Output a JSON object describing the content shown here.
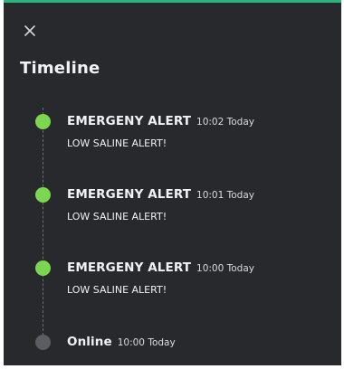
{
  "header": {
    "close_icon": "close-icon",
    "title": "Timeline"
  },
  "colors": {
    "background": "#27292c",
    "accent_top": "#2bb57a",
    "alert_dot": "#7cd64f",
    "online_dot": "#5a5d62"
  },
  "events": [
    {
      "title": "EMERGENY ALERT",
      "time": "10:02 Today",
      "message": "LOW SALINE ALERT!",
      "status": "alert"
    },
    {
      "title": "EMERGENY ALERT",
      "time": "10:01 Today",
      "message": "LOW SALINE ALERT!",
      "status": "alert"
    },
    {
      "title": "EMERGENY ALERT",
      "time": "10:00 Today",
      "message": "LOW SALINE ALERT!",
      "status": "alert"
    },
    {
      "title": "Online",
      "time": "10:00 Today",
      "status": "online"
    }
  ]
}
